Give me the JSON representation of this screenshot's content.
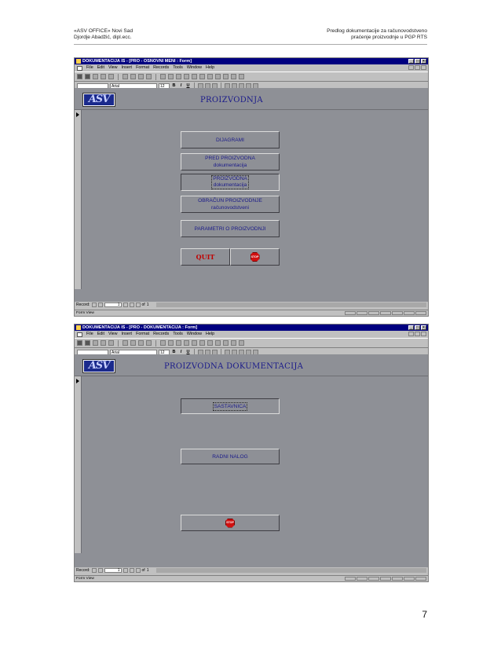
{
  "header": {
    "left_line1": "«ASV OFFICE» Novi Sad",
    "left_line2": "Djordje Abadžić, dipl.ecc.",
    "right_line1": "Predlog dokumentacije za računovodstveno",
    "right_line2": "praćenje proizvodnje u PGP RTS"
  },
  "page_number": "7",
  "app": {
    "menu": [
      "File",
      "Edit",
      "View",
      "Insert",
      "Format",
      "Records",
      "Tools",
      "Window",
      "Help"
    ],
    "font_name": "Arial",
    "font_size": "12",
    "bold": "B",
    "italic": "I",
    "underline": "U",
    "record_label": "Record:",
    "record_value": "1",
    "of_label": "of",
    "record_total": "1",
    "status": "Form View"
  },
  "window1": {
    "title": "DOKUMENTACIJA IS - [PRO - OSNOVNI MENI : Form]",
    "form_title": "PROIZVODNJA",
    "logo": "ASV",
    "buttons": [
      {
        "line1": "DIJAGRAMI",
        "line2": ""
      },
      {
        "line1": "PRED PROIZVODNA",
        "line2": "dokumentacija"
      },
      {
        "line1": "PROIZVODNA",
        "line2": "dokumentacija"
      },
      {
        "line1": "OBRAČUN PROIZVODNJE",
        "line2": "računovodstveni"
      },
      {
        "line1": "PARAMETRI O PROIZVODNJI",
        "line2": ""
      }
    ],
    "quit_label": "QUIT",
    "stop_label": "STOP"
  },
  "window2": {
    "title": "DOKUMENTACIJA IS - [PRO - DOKUMENTACIJA : Form]",
    "form_title": "PROIZVODNA DOKUMENTACIJA",
    "logo": "ASV",
    "buttons": [
      {
        "line1": "SASTAVNICA"
      },
      {
        "line1": "RADNI NALOG"
      }
    ],
    "stop_label": "STOP"
  },
  "colors": {
    "titlebar": "#000080",
    "form_bg": "#8e9096",
    "button_text": "#1b1b8a",
    "quit_text": "#c00000",
    "stop_sign": "#d01010"
  }
}
